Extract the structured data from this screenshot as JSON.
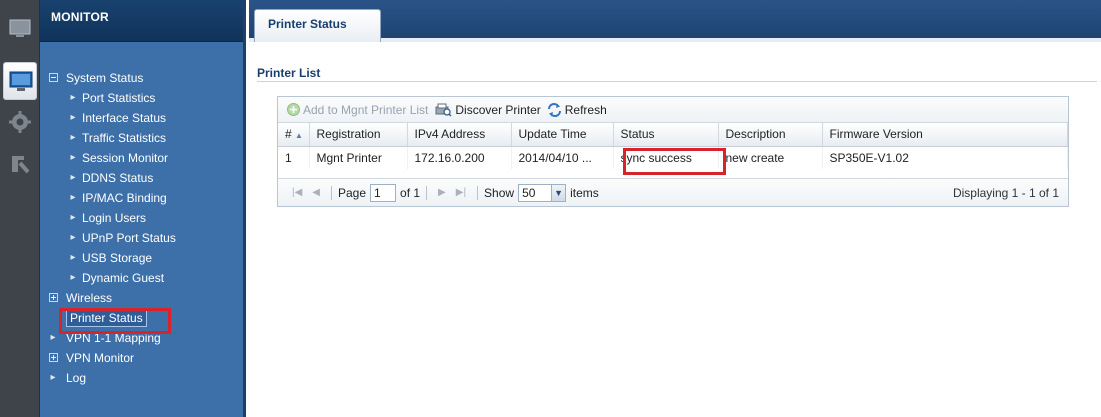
{
  "sidebar": {
    "header": "MONITOR",
    "items": [
      {
        "label": "System Status",
        "level": 0,
        "toggle": "minus"
      },
      {
        "label": "Port Statistics",
        "level": 1
      },
      {
        "label": "Interface Status",
        "level": 1
      },
      {
        "label": "Traffic Statistics",
        "level": 1
      },
      {
        "label": "Session Monitor",
        "level": 1
      },
      {
        "label": "DDNS Status",
        "level": 1
      },
      {
        "label": "IP/MAC Binding",
        "level": 1
      },
      {
        "label": "Login Users",
        "level": 1
      },
      {
        "label": "UPnP Port Status",
        "level": 1
      },
      {
        "label": "USB Storage",
        "level": 1
      },
      {
        "label": "Dynamic Guest",
        "level": 1
      },
      {
        "label": "Wireless",
        "level": 0,
        "toggle": "plus"
      },
      {
        "label": "Printer Status",
        "level": 0,
        "toggle": "none",
        "selected": true
      },
      {
        "label": "VPN 1-1 Mapping",
        "level": 0,
        "toggle": "arrow"
      },
      {
        "label": "VPN Monitor",
        "level": 0,
        "toggle": "plus"
      },
      {
        "label": "Log",
        "level": 0,
        "toggle": "arrow"
      }
    ]
  },
  "tabs": [
    {
      "label": "Printer Status",
      "active": true
    }
  ],
  "main": {
    "section_title": "Printer List",
    "toolbar": {
      "add_label": "Add to Mgnt Printer List",
      "discover_label": "Discover Printer",
      "refresh_label": "Refresh"
    },
    "table": {
      "columns": [
        "#",
        "Registration",
        "IPv4 Address",
        "Update Time",
        "Status",
        "Description",
        "Firmware Version"
      ],
      "sort_indicator": "▲",
      "rows": [
        [
          "1",
          "Mgnt Printer",
          "172.16.0.200",
          "2014/04/10 ...",
          "sync success",
          "new create",
          "SP350E-V1.02"
        ]
      ]
    },
    "pager": {
      "page_label": "Page",
      "page_value": "1",
      "of_label": "of 1",
      "show_label": "Show",
      "show_value": "50",
      "items_label": "items",
      "display_text": "Displaying 1 - 1 of 1"
    }
  },
  "colors": {
    "sidebar_bg": "#3d6fa8",
    "header_bg": "#10335a",
    "highlight_red": "#d8232a",
    "title_text": "#17406e"
  }
}
